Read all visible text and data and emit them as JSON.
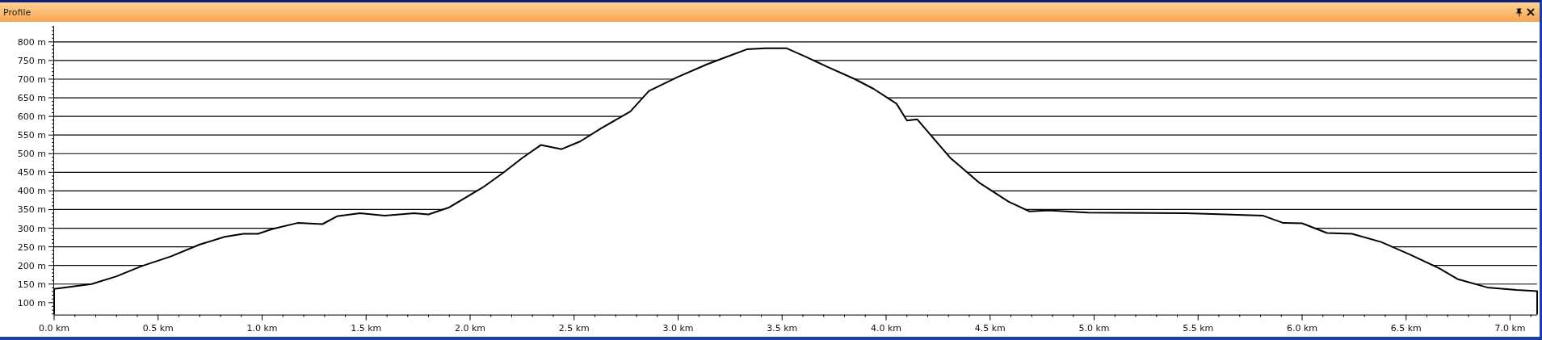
{
  "window": {
    "title": "Profile"
  },
  "chart_data": {
    "type": "area",
    "grid": true,
    "xlim": [
      0,
      7.13
    ],
    "ylim": [
      68,
      843
    ],
    "xticks": [
      {
        "value": 0,
        "label": "0.0 km"
      },
      {
        "value": 0.5,
        "label": "0.5 km"
      },
      {
        "value": 1,
        "label": "1.0 km"
      },
      {
        "value": 1.5,
        "label": "1.5 km"
      },
      {
        "value": 2,
        "label": "2.0 km"
      },
      {
        "value": 2.5,
        "label": "2.5 km"
      },
      {
        "value": 3,
        "label": "3.0 km"
      },
      {
        "value": 3.5,
        "label": "3.5 km"
      },
      {
        "value": 4,
        "label": "4.0 km"
      },
      {
        "value": 4.5,
        "label": "4.5 km"
      },
      {
        "value": 5,
        "label": "5.0 km"
      },
      {
        "value": 5.5,
        "label": "5.5 km"
      },
      {
        "value": 6,
        "label": "6.0 km"
      },
      {
        "value": 6.5,
        "label": "6.5 km"
      },
      {
        "value": 7,
        "label": "7.0 km"
      }
    ],
    "yticks": [
      {
        "value": 100,
        "label": "100 m"
      },
      {
        "value": 150,
        "label": "150 m"
      },
      {
        "value": 200,
        "label": "200 m"
      },
      {
        "value": 250,
        "label": "250 m"
      },
      {
        "value": 300,
        "label": "300 m"
      },
      {
        "value": 350,
        "label": "350 m"
      },
      {
        "value": 400,
        "label": "400 m"
      },
      {
        "value": 450,
        "label": "450 m"
      },
      {
        "value": 500,
        "label": "500 m"
      },
      {
        "value": 550,
        "label": "550 m"
      },
      {
        "value": 600,
        "label": "600 m"
      },
      {
        "value": 650,
        "label": "650 m"
      },
      {
        "value": 700,
        "label": "700 m"
      },
      {
        "value": 750,
        "label": "750 m"
      },
      {
        "value": 800,
        "label": "800 m"
      }
    ],
    "x": [
      0,
      0.18,
      0.3,
      0.42,
      0.56,
      0.7,
      0.82,
      0.91,
      0.98,
      1.05,
      1.17,
      1.29,
      1.36,
      1.47,
      1.59,
      1.73,
      1.8,
      1.9,
      2.06,
      2.16,
      2.25,
      2.34,
      2.44,
      2.53,
      2.63,
      2.77,
      2.86,
      3,
      3.14,
      3.23,
      3.33,
      3.42,
      3.52,
      3.61,
      3.71,
      3.85,
      3.94,
      4.05,
      4.1,
      4.15,
      4.31,
      4.45,
      4.59,
      4.69,
      4.78,
      4.97,
      5.44,
      5.81,
      5.91,
      6,
      6.12,
      6.24,
      6.38,
      6.52,
      6.66,
      6.75,
      6.89,
      7.03,
      7.13
    ],
    "series": [
      {
        "color": "#000000",
        "values": [
          137,
          150,
          171,
          198,
          224,
          256,
          277,
          285,
          285,
          298,
          314,
          311,
          332,
          340,
          334,
          340,
          337,
          356,
          409,
          449,
          488,
          523,
          512,
          533,
          568,
          613,
          668,
          706,
          740,
          759,
          780,
          783,
          783,
          761,
          735,
          700,
          674,
          634,
          589,
          592,
          488,
          421,
          371,
          345,
          348,
          342,
          340,
          334,
          314,
          313,
          287,
          285,
          263,
          229,
          192,
          163,
          141,
          134,
          131
        ]
      }
    ]
  }
}
